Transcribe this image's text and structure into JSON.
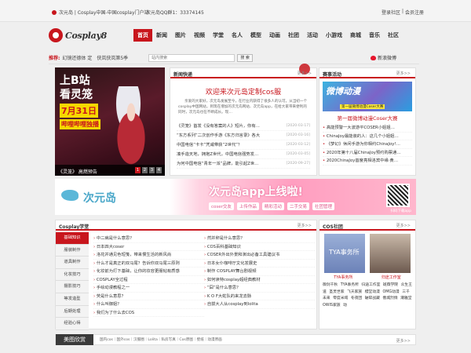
{
  "topbar": {
    "site": "次元岛 | Cosplay中国-中国cosplay门户站",
    "qq": "次元岛QQ群1：33374145",
    "login": "登录社区",
    "sep": "|",
    "register": "会员注册"
  },
  "logo": {
    "text": "Cosplay8"
  },
  "nav": [
    "首页",
    "新闻",
    "图片",
    "视频",
    "学堂",
    "名人",
    "模型",
    "动画",
    "社团",
    "活动",
    "小游戏",
    "商城",
    "音乐",
    "社区"
  ],
  "search": {
    "label": "推荐:",
    "hot": "幻镜还德体 定　侠岚侠岚第5季",
    "placeholder": "站内搜索",
    "button": "搜 索",
    "weibo": "新浪微博"
  },
  "hero": {
    "line1": "上B站",
    "line2": "看灵笼",
    "line3": "7月31日",
    "line4": "哔哩哔哩独播",
    "caption": "《灵笼》 高燃预告",
    "pages": [
      "1",
      "2",
      "3",
      "4"
    ]
  },
  "news": {
    "heading": "新闻快递",
    "more": "更多>>",
    "headline": "欢迎来次元岛定制cos服",
    "intro": "亲爱的大家好，次元岛发展至今，在行业内获得了很多人的认可。从当初一个cosplay中国网站，到现在增加的次元岛网站、次元岛app，在给大家带来便利的同时，次元岛也在不断成长。现…",
    "items": [
      {
        "title": "《灵笼》首发《没有答案的人》短片，你有…",
        "date": "[2020-03-17]"
      },
      {
        "title": "“东方系列”二次创作手游《东方归言录》各大",
        "date": "[2020-03-16]"
      },
      {
        "title": "中国电信“卡卡”凭咸带获“2世代”？",
        "date": "[2020-03-12]"
      },
      {
        "title": "凑手造天地，拥抱Z世代，中国电信强势发…",
        "date": "[2020-03-05]"
      },
      {
        "title": "为何中国电信“青年一派”品牌，能引起Z世…",
        "date": "[2020-09-27]"
      }
    ]
  },
  "events": {
    "heading": "赛事活动",
    "more": "更多>>",
    "image_title": "微博动漫",
    "image_sub": "第一届微博动漫Coser大赛",
    "title": "第一届微博动漫Coser大赛",
    "items": [
      "高能预警一大波游平COSER小姐姐…",
      "ChinaJoy最能装的人：这几个小姐姐…",
      "《梦幻》休闲手游为你相约ChinaJoy!…",
      "2020年第十八届ChinaJoy预约购票通…",
      "2020ChinaJoy首度亮相洛宾中缘·黄…"
    ]
  },
  "banner": {
    "brand": "次元岛",
    "slogan": "次元岛app上线啦!",
    "tags": [
      "coser交友",
      "上传作品",
      "精彩活动",
      "二手交易",
      "社团管理"
    ],
    "qr_label": "扫码下载app"
  },
  "school": {
    "heading": "Cosplay学堂",
    "more": "更多>>",
    "cats": [
      "基础知识",
      "服装制作",
      "道具制作",
      "化妆技巧",
      "摄影技巧",
      "等发造型",
      "后期处理",
      "经验心得"
    ],
    "left": [
      "中二病是什么意思？",
      "日本四大coser",
      "洛花并通见色短笺，带来慢生活的新风尚",
      "什么才是真正的双马尾？告诉你双马尾三原则",
      "化妆前为打下基础，让你的妆容更服帖有质感",
      "COSPLAY全过程",
      "手绘动漫教程之一",
      "荧是什么意思？",
      "什么叫御姐？",
      "我们为了什么去COS"
    ],
    "right": [
      "然并卵是什么意思？",
      "COS百科基础知识",
      "COSER外出外景和演出必备工具建议书",
      "日本女仆咖啡厅文化发展史",
      "制作 COSPLAY舞台剧视频",
      "如何读特cosplay超经典教材",
      "“囧”是什么意思？",
      "K O F大蛇队的来龙去脉",
      "自拔大人从cosplay到lolita"
    ]
  },
  "clubs": {
    "heading": "COS社团",
    "more": "更多>>",
    "p1": "TYA事务所",
    "n1": "TYA事务所",
    "n2": "归途工作室",
    "tags": "御剑千秋 TYA事务所 归途工作室 斑薇学院 众生王道 圣灵世家 飞天家族 櫻堂动漫 OMG动漫 三千未来 零度米域 冬夜团 破碎战藏 俄城烈情 潮雅堂 OWIS家族 动"
  },
  "strip": {
    "label": "美图欣赏",
    "links": "国内cos｜国外cos｜汉服圈｜Lolita｜私房写真｜Cos原图｜壁纸｜动漫原画",
    "more": "更多>>"
  }
}
